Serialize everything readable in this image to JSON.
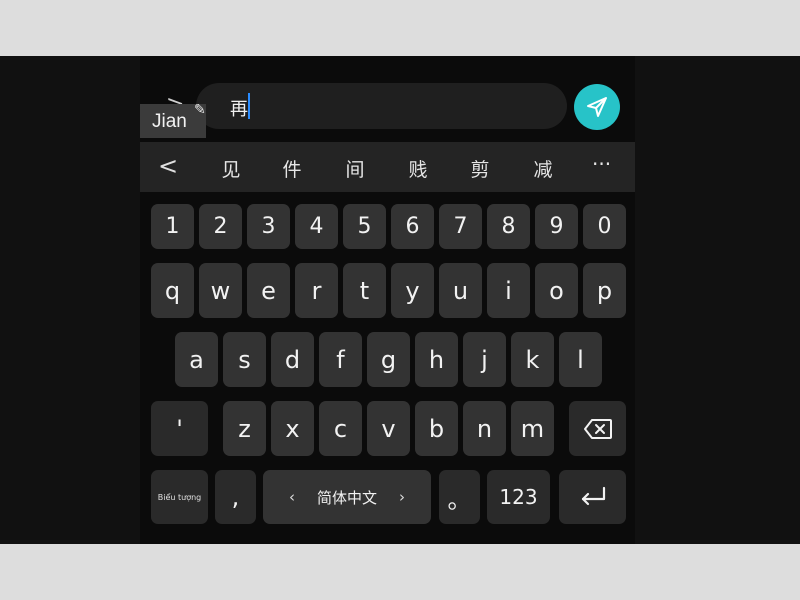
{
  "input": {
    "chevron": ">",
    "text": "再",
    "send_icon": "paper-plane-icon",
    "accent": "#27c3c8"
  },
  "ime": {
    "mode_label": "Jian",
    "edit_icon": "pencil-icon"
  },
  "candidates": {
    "back": "<",
    "items": [
      "见",
      "件",
      "间",
      "贱",
      "剪",
      "减"
    ],
    "more": "···"
  },
  "keyboard": {
    "number_row": [
      "1",
      "2",
      "3",
      "4",
      "5",
      "6",
      "7",
      "8",
      "9",
      "0"
    ],
    "row1": [
      "q",
      "w",
      "e",
      "r",
      "t",
      "y",
      "u",
      "i",
      "o",
      "p"
    ],
    "row2": [
      "a",
      "s",
      "d",
      "f",
      "g",
      "h",
      "j",
      "k",
      "l"
    ],
    "row3": [
      "z",
      "x",
      "c",
      "v",
      "b",
      "n",
      "m"
    ],
    "apostrophe": "'",
    "backspace_icon": "backspace-icon",
    "emoji_label": "Biểu tượng",
    "comma": ",",
    "space_left": "‹",
    "space_label": "简体中文",
    "space_right": "›",
    "period": "。",
    "numbers_toggle": "123",
    "enter_icon": "enter-icon"
  }
}
